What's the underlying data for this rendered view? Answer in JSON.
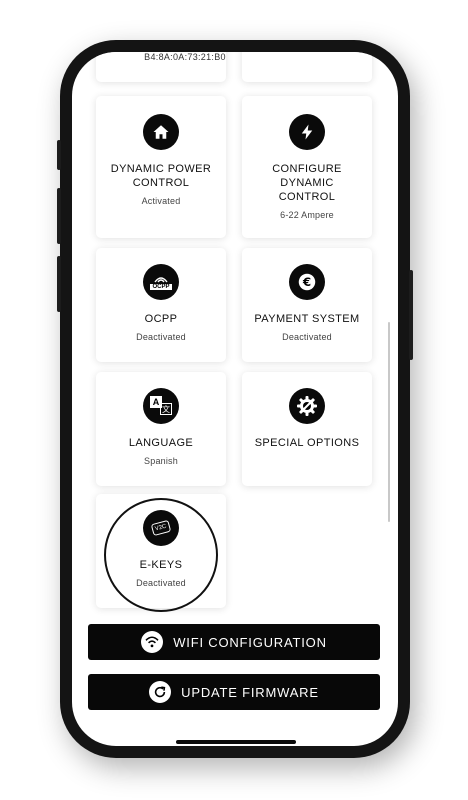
{
  "device": {
    "mac_address": "B4:8A:0A:73:21:B0"
  },
  "cards": [
    {
      "title": "DYNAMIC POWER CONTROL",
      "status": "Activated",
      "icon": "home-icon"
    },
    {
      "title": "CONFIGURE DYNAMIC CONTROL",
      "status": "6-22 Ampere",
      "icon": "lightning-icon"
    },
    {
      "title": "OCPP",
      "status": "Deactivated",
      "icon": "ocpp-icon"
    },
    {
      "title": "PAYMENT SYSTEM",
      "status": "Deactivated",
      "icon": "euro-icon"
    },
    {
      "title": "LANGUAGE",
      "status": "Spanish",
      "icon": "translate-icon"
    },
    {
      "title": "SPECIAL OPTIONS",
      "status": "",
      "icon": "gear-wrench-icon"
    },
    {
      "title": "E-KEYS",
      "status": "Deactivated",
      "icon": "ekey-icon",
      "highlighted": true
    }
  ],
  "icon_text": {
    "ocpp": "OCPP",
    "ekey": "V2C",
    "translate_a": "A",
    "translate_b": "文"
  },
  "buttons": {
    "wifi": {
      "label": "WIFI CONFIGURATION",
      "icon": "wifi-icon"
    },
    "update": {
      "label": "UPDATE FIRMWARE",
      "icon": "refresh-icon"
    }
  },
  "colors": {
    "accent": "#000000",
    "card_bg": "#ffffff",
    "text": "#111111"
  }
}
